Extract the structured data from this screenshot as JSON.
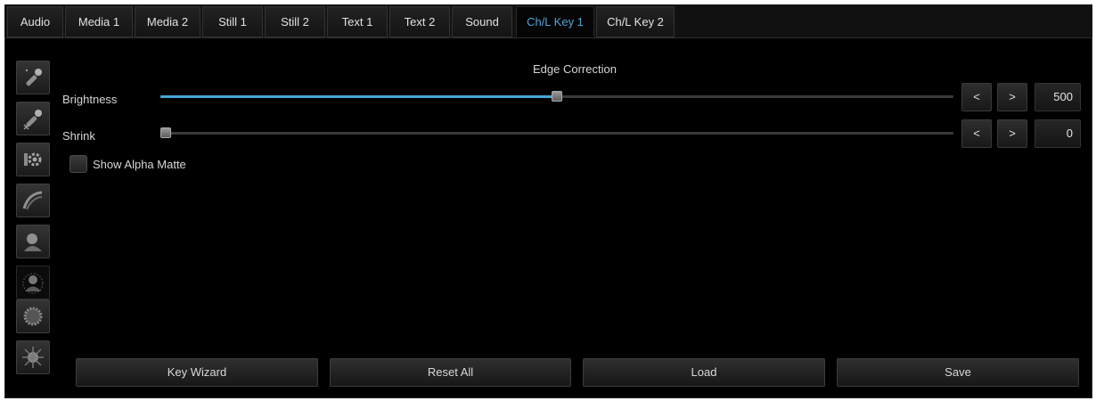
{
  "tabs": [
    {
      "label": "Audio",
      "active": false
    },
    {
      "label": "Media 1",
      "active": false
    },
    {
      "label": "Media 2",
      "active": false
    },
    {
      "label": "Still 1",
      "active": false
    },
    {
      "label": "Still 2",
      "active": false
    },
    {
      "label": "Text 1",
      "active": false
    },
    {
      "label": "Text 2",
      "active": false
    },
    {
      "label": "Sound",
      "active": false
    },
    {
      "label": "Ch/L Key 1",
      "active": true
    },
    {
      "label": "Ch/L Key 2",
      "active": false
    }
  ],
  "sidebar": {
    "icons": [
      {
        "name": "eyedropper-icon"
      },
      {
        "name": "eyedropper-remove-icon"
      },
      {
        "name": "gear-settings-icon"
      },
      {
        "name": "curve-icon"
      },
      {
        "name": "person-silhouette-icon"
      },
      {
        "name": "edge-person-icon",
        "selected": true
      },
      {
        "name": "circle-mask-icon"
      },
      {
        "name": "sparkle-icon"
      }
    ]
  },
  "panel": {
    "title": "Edge Correction",
    "brightness": {
      "label": "Brightness",
      "value": "500",
      "fraction": 0.5,
      "dec_label": "<",
      "inc_label": ">"
    },
    "shrink": {
      "label": "Shrink",
      "value": "0",
      "fraction": 0.0,
      "dec_label": "<",
      "inc_label": ">"
    },
    "show_alpha_matte": {
      "label": "Show Alpha Matte",
      "checked": false
    }
  },
  "footer": {
    "key_wizard": "Key Wizard",
    "reset_all": "Reset All",
    "load": "Load",
    "save": "Save"
  },
  "colors": {
    "accent": "#45a6d9",
    "background": "#000000"
  }
}
